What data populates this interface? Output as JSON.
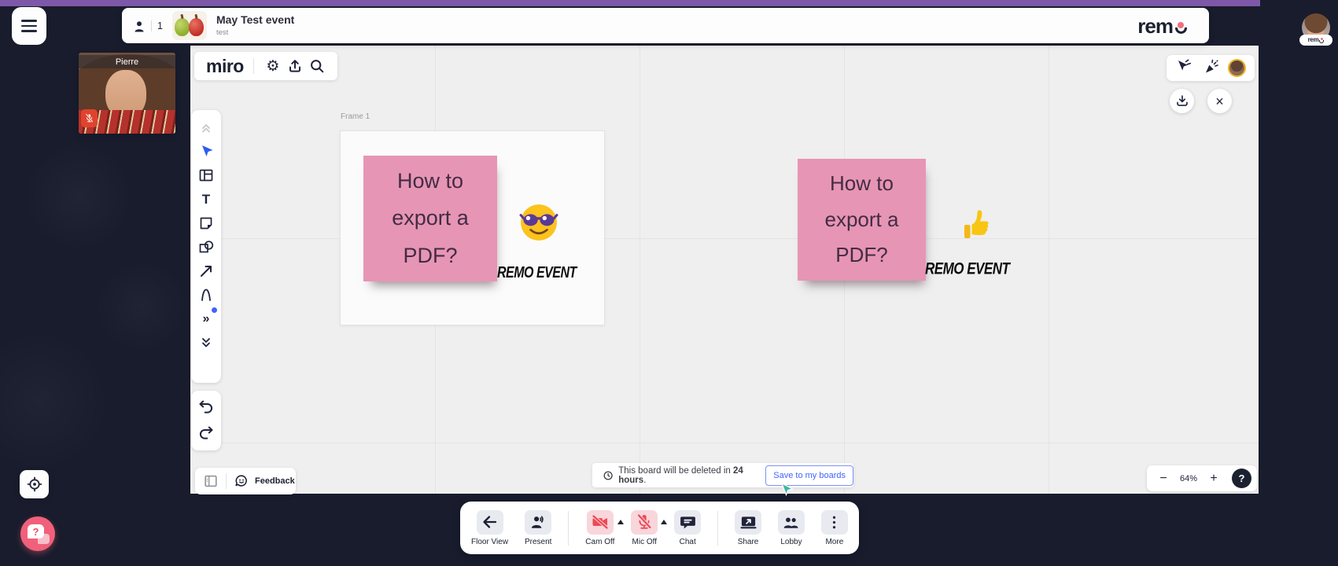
{
  "colors": {
    "accent_purple": "#7e58a8",
    "sticky_pink": "#e795b5",
    "danger_red": "#ee4956",
    "save_blue": "#4262ff",
    "help_pink": "#f0607b"
  },
  "top_bar": {
    "attendee_count": "1",
    "event_title": "May Test event",
    "event_subtitle": "test",
    "remo_wordmark": "rem",
    "avatar_badge_text": "rem"
  },
  "video_tile": {
    "name": "Pierre"
  },
  "miro": {
    "logo": "miro",
    "gear_glyph": "⚙",
    "text_tool_glyph": "T",
    "more_tools_glyph": "»",
    "frame_label": "Frame 1",
    "tools": [
      "collapse",
      "select",
      "frame",
      "text",
      "sticky-note",
      "shapes",
      "arrow",
      "pen",
      "more",
      "expand-down"
    ],
    "stickies": [
      {
        "text": "How to export a PDF?",
        "caption": "REMO EVENT",
        "emoji": "sunglasses-face"
      },
      {
        "text": "How to export a PDF?",
        "caption": "REMO EVENT",
        "emoji": "thumbs-up"
      }
    ],
    "banner": {
      "prefix": "This board will be deleted in ",
      "bold": "24 hours",
      "suffix": ".",
      "save_button": "Save to my boards"
    },
    "feedback_label": "Feedback",
    "zoom": {
      "minus": "−",
      "level": "64%",
      "plus": "+",
      "help": "?"
    },
    "close_glyph": "×"
  },
  "bottom_toolbar": {
    "items": [
      {
        "label": "Floor View"
      },
      {
        "label": "Present"
      },
      {
        "label": "Cam Off",
        "caret": true
      },
      {
        "label": "Mic Off",
        "caret": true
      },
      {
        "label": "Chat"
      },
      {
        "label": "Share"
      },
      {
        "label": "Lobby"
      },
      {
        "label": "More"
      }
    ]
  }
}
